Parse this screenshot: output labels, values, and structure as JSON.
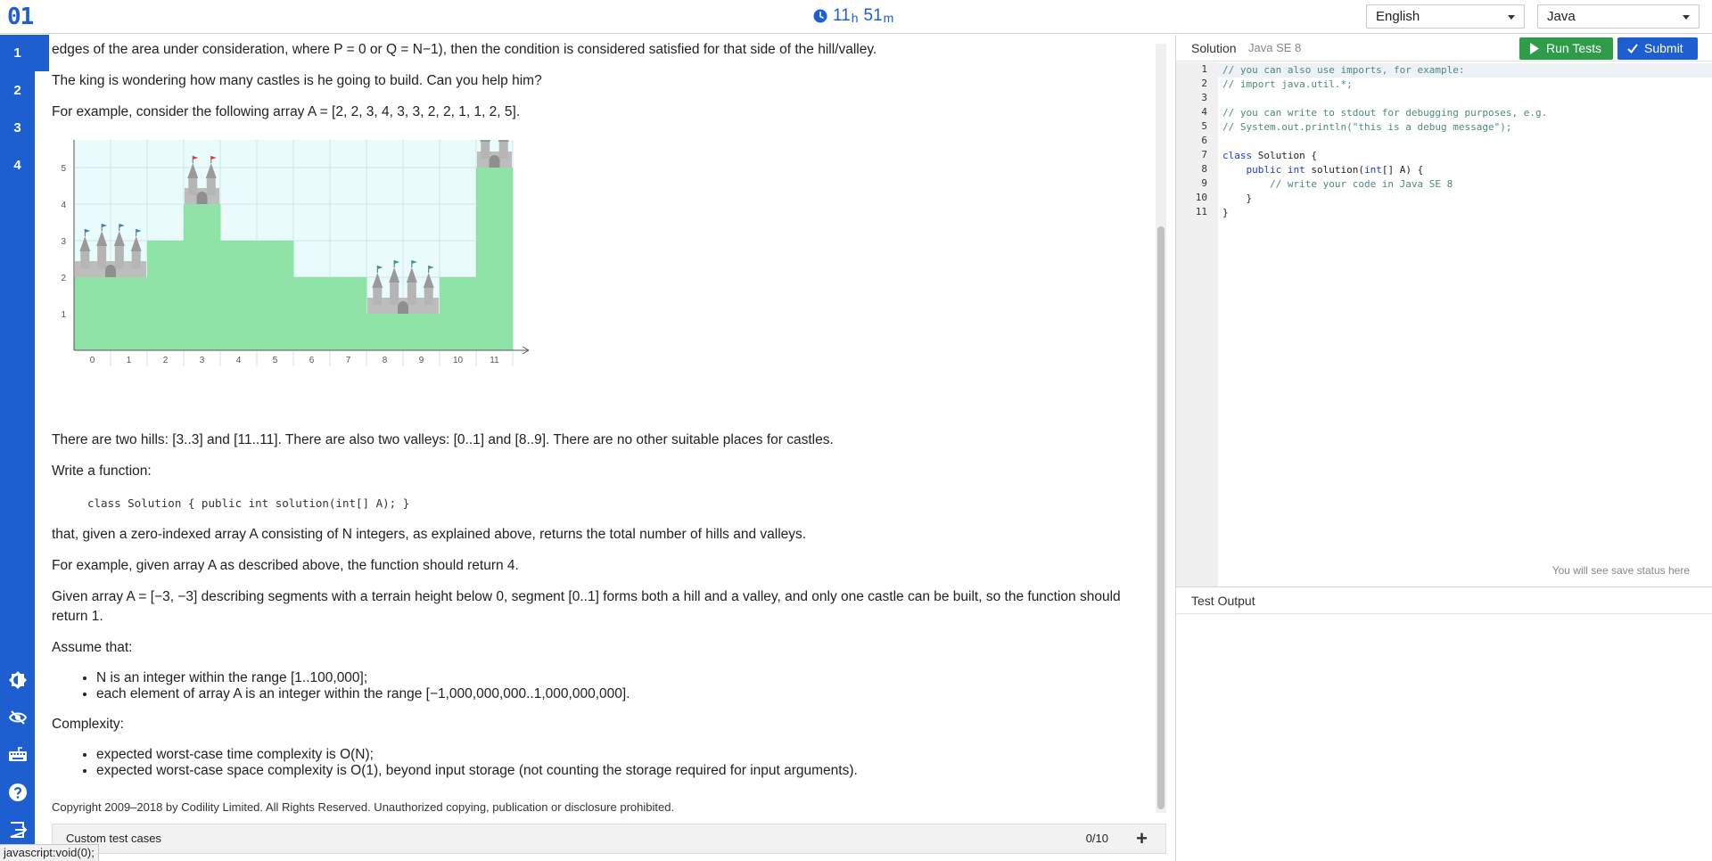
{
  "app": {
    "logo": "01",
    "timer": {
      "hours": "11",
      "hours_unit": "h",
      "minutes": "51",
      "minutes_unit": "m"
    },
    "language_select": "English",
    "programming_select": "Java"
  },
  "sidebar": {
    "tasks": [
      "1",
      "2",
      "3",
      "4"
    ],
    "active_task": "1",
    "icons": [
      "theme-toggle-icon",
      "eye-hide-icon",
      "keyboard-icon",
      "help-icon",
      "exit-icon"
    ]
  },
  "problem": {
    "p1": "edges of the area under consideration, where P = 0 or Q = N−1), then the condition is considered satisfied for that side of the hill/valley.",
    "p2": "The king is wondering how many castles is he going to build. Can you help him?",
    "p3": "For example, consider the following array A = [2, 2, 3, 4, 3, 3, 2, 2, 1, 1, 2, 5].",
    "p4": "There are two hills: [3..3] and [11..11]. There are also two valleys: [0..1] and [8..9]. There are no other suitable places for castles.",
    "p5": "Write a function:",
    "signature": "class Solution { public int solution(int[] A); }",
    "p6": "that, given a zero-indexed array A consisting of N integers, as explained above, returns the total number of hills and valleys.",
    "p7": "For example, given array A as described above, the function should return 4.",
    "p8": "Given array A = [−3, −3] describing segments with a terrain height below 0, segment [0..1] forms both a hill and a valley, and only one castle can be built, so the function should return 1.",
    "p9": "Assume that:",
    "assume": [
      "N is an integer within the range [1..100,000];",
      "each element of array A is an integer within the range [−1,000,000,000..1,000,000,000]."
    ],
    "p10": "Complexity:",
    "complexity": [
      "expected worst-case time complexity is O(N);",
      "expected worst-case space complexity is O(1), beyond input storage (not counting the storage required for input arguments)."
    ],
    "copyright": "Copyright 2009–2018 by Codility Limited. All Rights Reserved. Unauthorized copying, publication or disclosure prohibited."
  },
  "chart_data": {
    "type": "bar",
    "categories": [
      "0",
      "1",
      "2",
      "3",
      "4",
      "5",
      "6",
      "7",
      "8",
      "9",
      "10",
      "11"
    ],
    "values": [
      2,
      2,
      3,
      4,
      3,
      3,
      2,
      2,
      1,
      1,
      2,
      5
    ],
    "ylim": [
      0,
      6
    ],
    "yticks": [
      "1",
      "2",
      "3",
      "4",
      "5",
      "6"
    ],
    "castles_at": [
      0,
      3,
      8,
      11
    ],
    "colors": {
      "fill": "#8fe3a6",
      "background": "#e9fbfb",
      "castle": "#bdbdbd"
    }
  },
  "custom_tests": {
    "label": "Custom test cases",
    "count": "0/10",
    "add": "+"
  },
  "statusbar": "javascript:void(0);",
  "editor": {
    "title": "Solution",
    "lang": "Java SE 8",
    "run_label": "Run Tests",
    "submit_label": "Submit",
    "save_status": "You will see save status here",
    "lines": [
      "// you can also use imports, for example:",
      "// import java.util.*;",
      "",
      "// you can write to stdout for debugging purposes, e.g.",
      "// System.out.println(\"this is a debug message\");",
      "",
      "class Solution {",
      "    public int solution(int[] A) {",
      "        // write your code in Java SE 8",
      "    }",
      "}"
    ],
    "line_numbers": [
      "1",
      "2",
      "3",
      "4",
      "5",
      "6",
      "7",
      "8",
      "9",
      "10",
      "11"
    ]
  },
  "output": {
    "title": "Test Output"
  }
}
